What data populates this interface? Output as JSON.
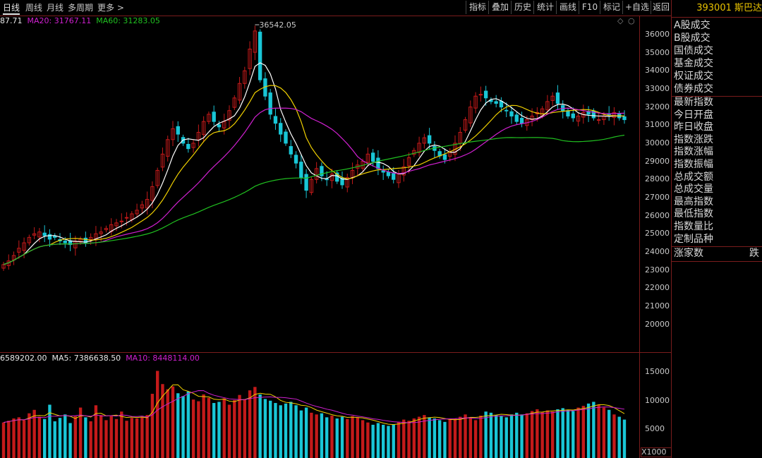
{
  "toolbar": {
    "tabs": [
      "日线",
      "周线",
      "月线",
      "多周期",
      "更多 >"
    ],
    "buttons": [
      "指标",
      "叠加",
      "历史",
      "统计",
      "画线",
      "F10",
      "标记",
      "+自选",
      "返回"
    ]
  },
  "price_legend": {
    "ma5": "87.71",
    "ma20": "MA20: 31767.11",
    "ma60": "MA60: 31283.05"
  },
  "volume_legend": {
    "vol": "6589202.00",
    "ma5": "MA5: 7386638.50",
    "ma10": "MA10: 8448114.00"
  },
  "volume_multiplier": "X1000",
  "colors": {
    "up": "#c41a1a",
    "down": "#19c6d6",
    "ma5": "#ffffff",
    "ma10": "#f0d000",
    "ma20": "#d020d0",
    "ma60": "#20c020",
    "frame": "#7a1c1c",
    "right_title": "#e8c200"
  },
  "right_panel": {
    "title": "393001 斯巴达",
    "group1": [
      "A股成交",
      "B股成交",
      "国债成交",
      "基金成交",
      "权证成交",
      "债券成交"
    ],
    "group2": [
      "最新指数",
      "今日开盘",
      "昨日收盘",
      "指数涨跌",
      "指数涨幅",
      "指数振幅",
      "总成交额",
      "总成交量",
      "最高指数",
      "最低指数",
      "指数量比",
      "定制品种"
    ],
    "footer_left": "涨家数",
    "footer_right": "跌"
  },
  "chart_data": {
    "type": "candlestick",
    "price_axis": {
      "ticks": [
        20000,
        21000,
        22000,
        23000,
        24000,
        25000,
        26000,
        27000,
        28000,
        29000,
        30000,
        31000,
        32000,
        33000,
        34000,
        35000,
        36000
      ],
      "range": [
        19000,
        36900
      ]
    },
    "peak_label": "36542.05",
    "close": [
      23300,
      23500,
      23800,
      24200,
      24500,
      24800,
      25000,
      25100,
      24900,
      24700,
      24800,
      24600,
      24500,
      24400,
      24600,
      24700,
      24500,
      24800,
      25000,
      25100,
      25300,
      25500,
      25600,
      25700,
      25900,
      26100,
      26300,
      26600,
      26900,
      27600,
      28500,
      29400,
      30200,
      30800,
      30500,
      30000,
      29700,
      30000,
      30600,
      31200,
      31600,
      31200,
      30900,
      31200,
      31800,
      32500,
      33300,
      34000,
      35200,
      36200,
      33500,
      32600,
      31600,
      31100,
      30500,
      30000,
      29400,
      28900,
      28100,
      27400,
      28000,
      28600,
      28200,
      28000,
      28300,
      27900,
      27700,
      28100,
      28500,
      28800,
      29000,
      29400,
      29000,
      28600,
      28400,
      28200,
      28000,
      28300,
      28700,
      29200,
      29600,
      30000,
      30300,
      30000,
      29600,
      29300,
      29100,
      29500,
      30000,
      30600,
      31300,
      32000,
      32600,
      32700,
      32500,
      32300,
      32200,
      32000,
      31800,
      31500,
      31200,
      31100,
      31300,
      31500,
      31700,
      31900,
      32300,
      32600,
      32200,
      31800,
      31500,
      31400,
      31500,
      31700,
      31600,
      31400,
      31300,
      31500,
      31600,
      31700,
      31400,
      31300
    ],
    "ma_series": [
      {
        "name": "MA5",
        "color": "#ffffff"
      },
      {
        "name": "MA10",
        "color": "#f0d000"
      },
      {
        "name": "MA20",
        "color": "#d020d0"
      },
      {
        "name": "MA60",
        "color": "#20c020"
      }
    ],
    "volume_axis": {
      "ticks": [
        5000,
        10000,
        15000
      ],
      "range": [
        0,
        17000
      ],
      "unit": "X1000"
    },
    "volume": [
      6200,
      6500,
      6900,
      7100,
      6600,
      7800,
      8400,
      7200,
      6800,
      9300,
      6400,
      7000,
      7600,
      6100,
      7300,
      8800,
      7100,
      6400,
      9200,
      7500,
      6600,
      7300,
      6800,
      8100,
      6500,
      7000,
      6900,
      7200,
      7500,
      11200,
      15200,
      12900,
      12000,
      12500,
      11300,
      10800,
      11600,
      10200,
      9900,
      11100,
      10500,
      9600,
      9800,
      10400,
      9300,
      10100,
      11000,
      10200,
      11800,
      12400,
      11100,
      10300,
      10000,
      9600,
      9200,
      9500,
      9800,
      9200,
      8300,
      8800,
      7900,
      7600,
      7800,
      7100,
      7400,
      6900,
      7200,
      6800,
      7300,
      7100,
      6600,
      6200,
      5800,
      6100,
      5800,
      5600,
      5900,
      6300,
      6700,
      6500,
      6900,
      7200,
      7500,
      7100,
      6900,
      6600,
      6300,
      6700,
      6900,
      7200,
      7600,
      7100,
      6600,
      7400,
      8100,
      7900,
      7500,
      7300,
      7100,
      7600,
      7900,
      7600,
      7800,
      8200,
      8500,
      8000,
      8300,
      8100,
      8500,
      8700,
      8400,
      8200,
      8800,
      9100,
      9500,
      9800,
      9300,
      8800,
      8400,
      7600,
      7200,
      6700
    ]
  }
}
